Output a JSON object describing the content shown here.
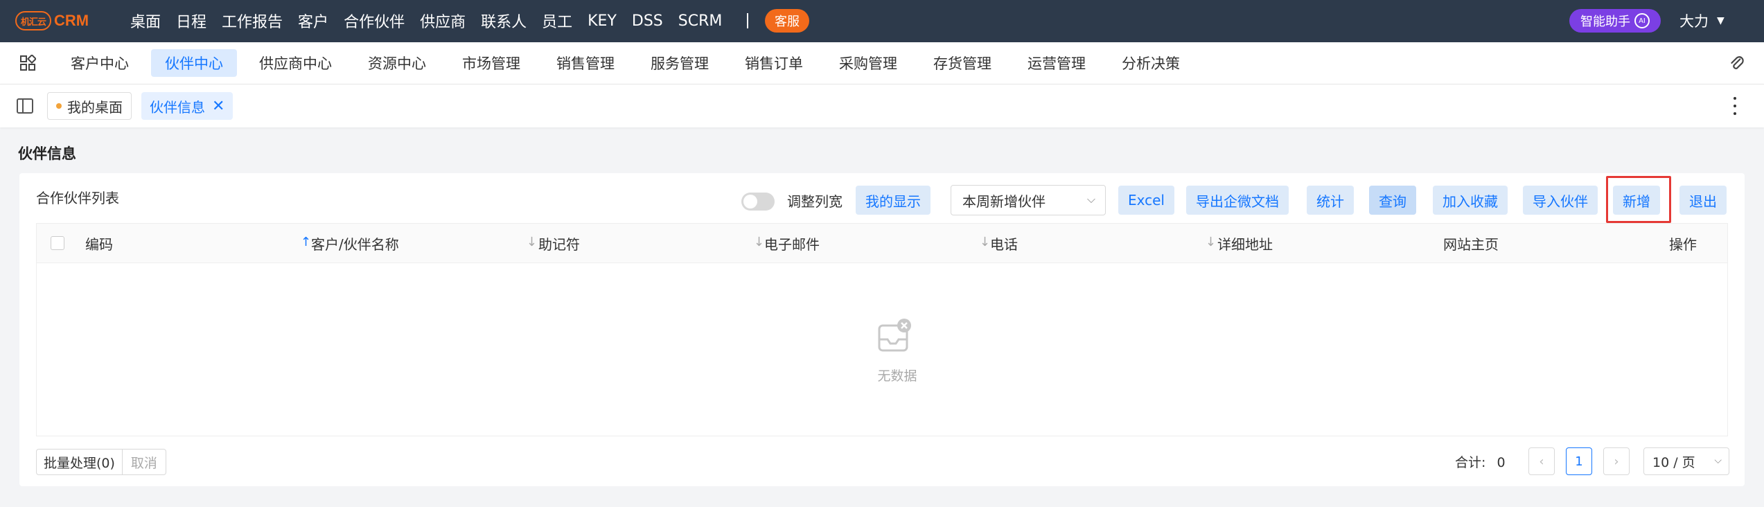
{
  "brand": {
    "badge": "机汇云",
    "name": "CRM",
    "accent": "#f26a1b"
  },
  "topnav": [
    "桌面",
    "日程",
    "工作报告",
    "客户",
    "合作伙伴",
    "供应商",
    "联系人",
    "员工",
    "KEY",
    "DSS",
    "SCRM"
  ],
  "topbar": {
    "support": "客服",
    "ai_assistant": "智能助手",
    "ai_badge": "AI",
    "user": "大力",
    "user_chevron": "chevron-down-icon"
  },
  "modules": [
    "客户中心",
    "伙伴中心",
    "供应商中心",
    "资源中心",
    "市场管理",
    "销售管理",
    "服务管理",
    "销售订单",
    "采购管理",
    "存货管理",
    "运营管理",
    "分析决策"
  ],
  "active_module": "伙伴中心",
  "tabs": {
    "home": "我的桌面",
    "current": "伙伴信息",
    "close": "✕"
  },
  "page": {
    "title": "伙伴信息"
  },
  "card": {
    "title": "合作伙伴列表",
    "toggle_label": "调整列宽",
    "my_display": "我的显示",
    "filter_value": "本周新增伙伴",
    "buttons": [
      "Excel",
      "导出企微文档",
      "统计",
      "查询",
      "加入收藏",
      "导入伙伴",
      "新增",
      "退出"
    ]
  },
  "table": {
    "columns": [
      "编码",
      "客户/伙伴名称",
      "助记符",
      "电子邮件",
      "电话",
      "详细地址",
      "网站主页",
      "操作"
    ],
    "empty_text": "无数据"
  },
  "footer": {
    "batch": "批量处理(0)",
    "cancel": "取消",
    "total_label": "合计:",
    "total_value": "0",
    "current_page": "1",
    "page_size": "10 / 页"
  }
}
